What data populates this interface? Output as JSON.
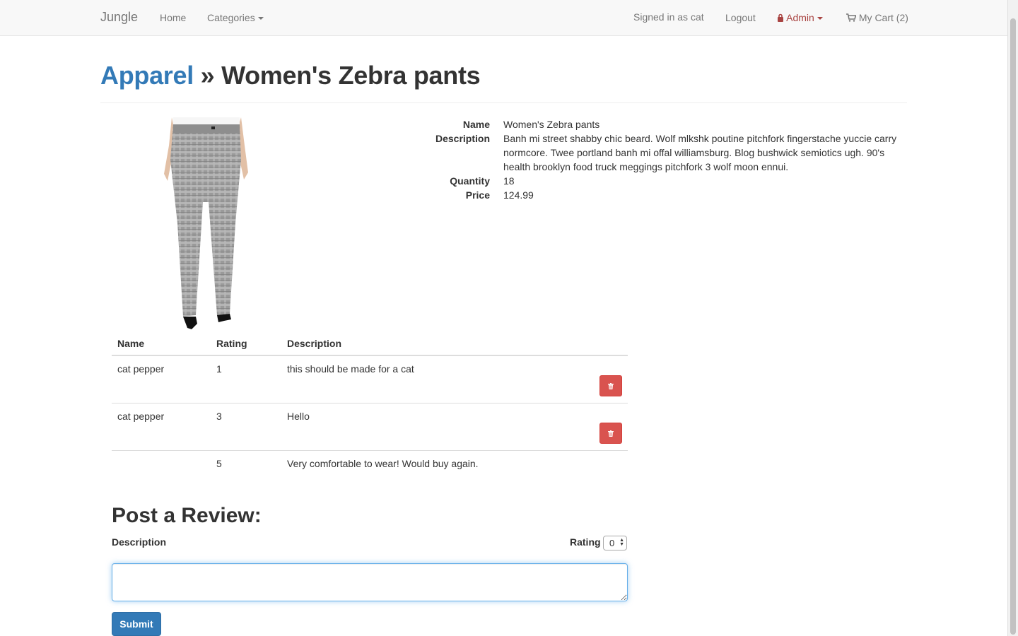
{
  "nav": {
    "brand": "Jungle",
    "home": "Home",
    "categories": "Categories",
    "signed_in": "Signed in as cat",
    "logout": "Logout",
    "admin": "Admin",
    "cart": "My Cart (2)"
  },
  "header": {
    "category": "Apparel",
    "separator": "»",
    "title": "Women's Zebra pants"
  },
  "details": {
    "name_label": "Name",
    "name": "Women's Zebra pants",
    "description_label": "Description",
    "description": "Banh mi street shabby chic beard. Wolf mlkshk poutine pitchfork fingerstache yuccie carry normcore. Twee portland banh mi offal williamsburg. Blog bushwick semiotics ugh. 90's health brooklyn food truck meggings pitchfork 3 wolf moon ennui.",
    "quantity_label": "Quantity",
    "quantity": "18",
    "price_label": "Price",
    "price": "124.99"
  },
  "reviews": {
    "headers": {
      "name": "Name",
      "rating": "Rating",
      "description": "Description"
    },
    "rows": [
      {
        "name": "cat pepper",
        "rating": "1",
        "description": "this should be made for a cat"
      },
      {
        "name": "cat pepper",
        "rating": "3",
        "description": "Hello"
      },
      {
        "name": "",
        "rating": "5",
        "description": "Very comfortable to wear! Would buy again."
      }
    ]
  },
  "form": {
    "heading": "Post a Review:",
    "description_label": "Description",
    "rating_label": "Rating",
    "rating_value": "0",
    "description_value": "",
    "submit": "Submit"
  },
  "colors": {
    "link": "#337ab7",
    "danger": "#d9534f",
    "admin": "#a94442",
    "primary": "#337ab7"
  }
}
